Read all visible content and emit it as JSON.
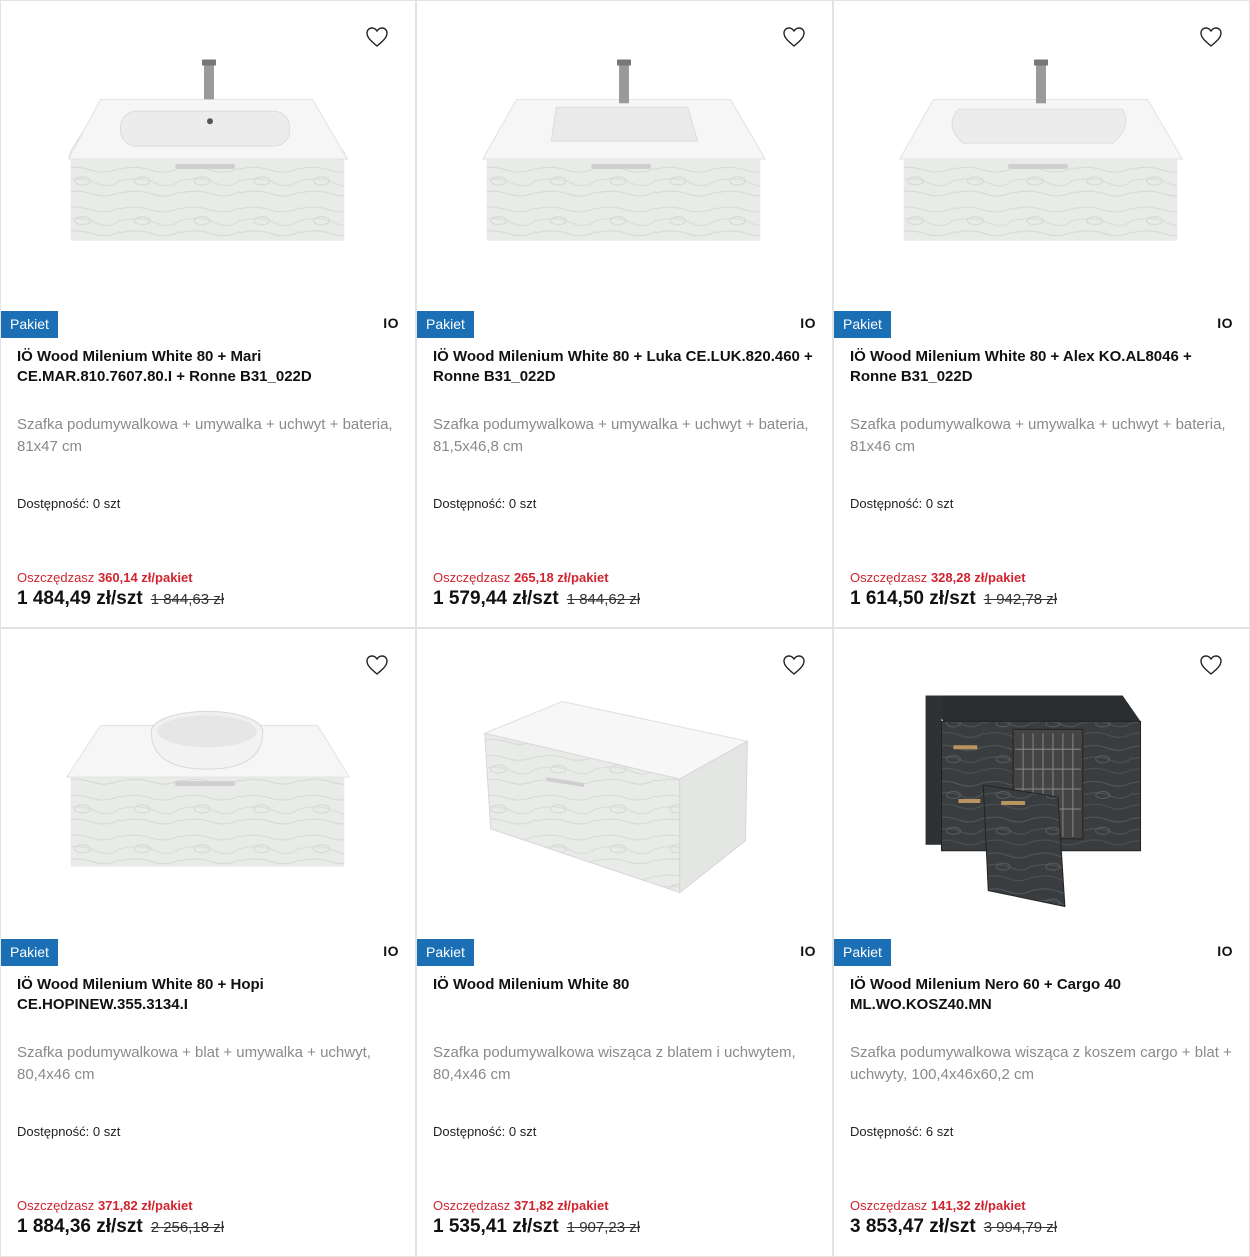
{
  "colors": {
    "badge": "#1a6fb5",
    "savings": "#d1242f"
  },
  "labels": {
    "stock_prefix": "Dostępność:",
    "save_prefix": "Oszczędzasz"
  },
  "products": [
    {
      "badge": "Pakiet",
      "brand": "IO",
      "title": "IÖ Wood Milenium White 80 + Mari CE.MAR.810.7607.80.I + Ronne B31_022D",
      "desc": "Szafka podumywalkowa + umywalka + uchwyt + bateria, 81x47 cm",
      "stock": "0 szt",
      "save": "360,14 zł/pakiet",
      "price": "1 484,49 zł/szt",
      "old_price": "1 844,63 zł",
      "image": "vanity-sink-mari",
      "favorite_icon": "heart-icon"
    },
    {
      "badge": "Pakiet",
      "brand": "IO",
      "title": "IÖ Wood Milenium White 80 + Luka CE.LUK.820.460 + Ronne B31_022D",
      "desc": "Szafka podumywalkowa + umywalka + uchwyt + bateria, 81,5x46,8 cm",
      "stock": "0 szt",
      "save": "265,18 zł/pakiet",
      "price": "1 579,44 zł/szt",
      "old_price": "1 844,62 zł",
      "image": "vanity-sink-luka",
      "favorite_icon": "heart-icon"
    },
    {
      "badge": "Pakiet",
      "brand": "IO",
      "title": "IÖ Wood Milenium White 80 + Alex KO.AL8046 + Ronne B31_022D",
      "desc": "Szafka podumywalkowa + umywalka + uchwyt + bateria, 81x46 cm",
      "stock": "0 szt",
      "save": "328,28 zł/pakiet",
      "price": "1 614,50 zł/szt",
      "old_price": "1 942,78 zł",
      "image": "vanity-sink-alex",
      "favorite_icon": "heart-icon"
    },
    {
      "badge": "Pakiet",
      "brand": "IO",
      "title": "IÖ Wood Milenium White 80 + Hopi CE.HOPINEW.355.3134.I",
      "desc": "Szafka podumywalkowa + blat + umywalka + uchwyt, 80,4x46 cm",
      "stock": "0 szt",
      "save": "371,82 zł/pakiet",
      "price": "1 884,36 zł/szt",
      "old_price": "2 256,18 zł",
      "image": "vanity-bowl-hopi",
      "favorite_icon": "heart-icon"
    },
    {
      "badge": "Pakiet",
      "brand": "IO",
      "title": "IÖ Wood Milenium White 80",
      "desc": "Szafka podumywalkowa wisząca z blatem i uchwytem, 80,4x46 cm",
      "stock": "0 szt",
      "save": "371,82 zł/pakiet",
      "price": "1 535,41 zł/szt",
      "old_price": "1 907,23 zł",
      "image": "vanity-cabinet-white",
      "favorite_icon": "heart-icon"
    },
    {
      "badge": "Pakiet",
      "brand": "IO",
      "title": "IÖ Wood Milenium Nero 60 + Cargo 40 ML.WO.KOSZ40.MN",
      "desc": "Szafka podumywalkowa wisząca z koszem cargo + blat + uchwyty, 100,4x46x60,2 cm",
      "stock": "6 szt",
      "save": "141,32 zł/pakiet",
      "price": "3 853,47 zł/szt",
      "old_price": "3 994,79 zł",
      "image": "vanity-cabinet-nero-cargo",
      "favorite_icon": "heart-icon"
    }
  ]
}
